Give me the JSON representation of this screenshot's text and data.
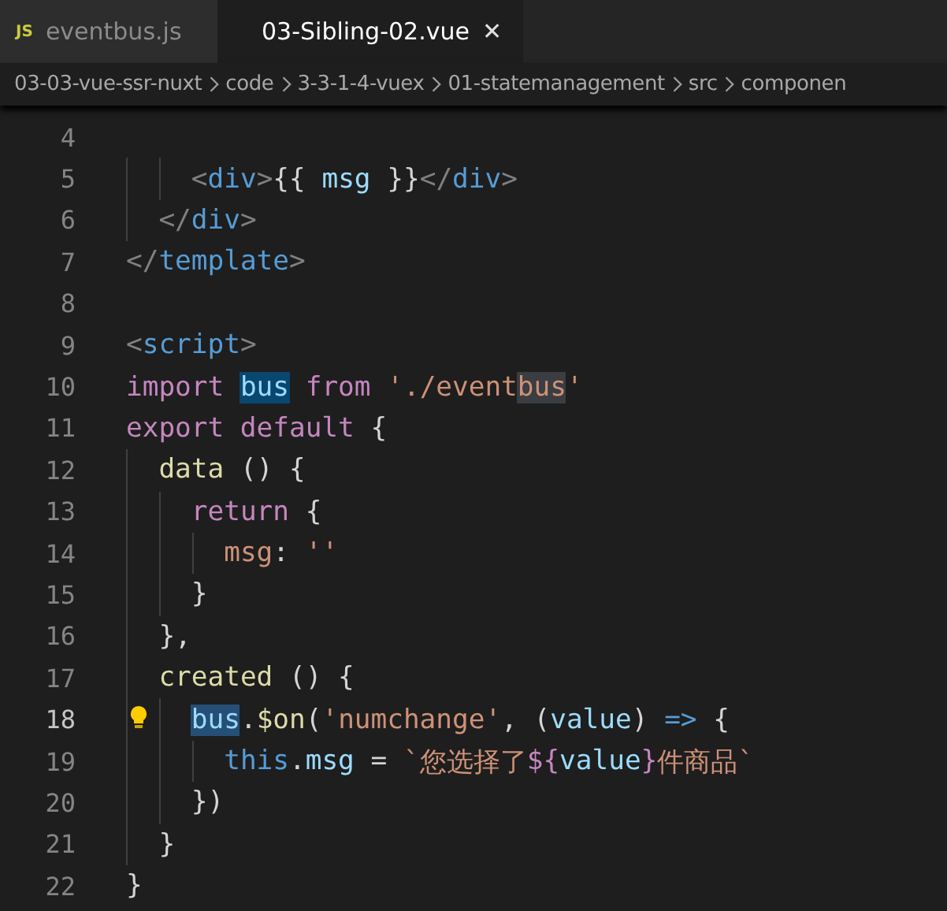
{
  "tabs": [
    {
      "label": "eventbus.js",
      "icon": "JS",
      "kind": "js",
      "selected": false
    },
    {
      "label": "03-Sibling-02.vue",
      "kind": "vue",
      "selected": true,
      "close": "✕"
    }
  ],
  "breadcrumbs": [
    "03-03-vue-ssr-nuxt",
    "code",
    "3-3-1-4-vuex",
    "01-statemanagement",
    "src",
    "componen"
  ],
  "lines": [
    {
      "number": "4",
      "current": false
    },
    {
      "number": "5",
      "current": false,
      "tokens": [
        {
          "text": "    <",
          "kind": "bracket"
        },
        {
          "text": "div",
          "kind": "tag"
        },
        {
          "text": ">",
          "kind": "bracket"
        },
        {
          "text": "{{ ",
          "kind": "text"
        },
        {
          "text": "msg",
          "kind": "variable"
        },
        {
          "text": " }}",
          "kind": "text"
        },
        {
          "text": "</",
          "kind": "bracket"
        },
        {
          "text": "div",
          "kind": "tag"
        },
        {
          "text": ">",
          "kind": "bracket"
        }
      ]
    },
    {
      "number": "6",
      "current": false,
      "tokens": [
        {
          "text": "  </",
          "kind": "bracket"
        },
        {
          "text": "div",
          "kind": "tag"
        },
        {
          "text": ">",
          "kind": "bracket"
        }
      ]
    },
    {
      "number": "7",
      "current": false,
      "tokens": [
        {
          "text": "</",
          "kind": "bracket"
        },
        {
          "text": "template",
          "kind": "tag"
        },
        {
          "text": ">",
          "kind": "bracket"
        }
      ]
    },
    {
      "number": "8",
      "current": false
    },
    {
      "number": "9",
      "current": false,
      "tokens": [
        {
          "text": "<",
          "kind": "bracket"
        },
        {
          "text": "script",
          "kind": "tag"
        },
        {
          "text": ">",
          "kind": "bracket"
        }
      ]
    },
    {
      "number": "10",
      "current": false,
      "tokens": [
        {
          "text": "import ",
          "kind": "keyword"
        },
        {
          "text": "bus",
          "kind": "highlight"
        },
        {
          "text": " from",
          "kind": "keyword"
        },
        {
          "text": " './event",
          "kind": "string"
        },
        {
          "text": "bus",
          "kind": "match"
        },
        {
          "text": "'",
          "kind": "string"
        }
      ]
    },
    {
      "number": "11",
      "current": false,
      "tokens": [
        {
          "text": "export default",
          "kind": "keyword"
        },
        {
          "text": " {",
          "kind": "text"
        }
      ]
    },
    {
      "number": "12",
      "current": false,
      "tokens": [
        {
          "text": "  data",
          "kind": "function"
        },
        {
          "text": " () {",
          "kind": "text"
        }
      ]
    },
    {
      "number": "13",
      "current": false,
      "tokens": [
        {
          "text": "    return",
          "kind": "keyword"
        },
        {
          "text": " {",
          "kind": "text"
        }
      ]
    },
    {
      "number": "14",
      "current": false,
      "tokens": [
        {
          "text": "      msg",
          "kind": "string"
        },
        {
          "text": ": ",
          "kind": "text"
        },
        {
          "text": "''",
          "kind": "string"
        }
      ]
    },
    {
      "number": "15",
      "current": false,
      "tokens": [
        {
          "text": "    }",
          "kind": "text"
        }
      ]
    },
    {
      "number": "16",
      "current": false,
      "tokens": [
        {
          "text": "  },",
          "kind": "text"
        }
      ]
    },
    {
      "number": "17",
      "current": false,
      "tokens": [
        {
          "text": "  created",
          "kind": "function"
        },
        {
          "text": " () {",
          "kind": "text"
        }
      ]
    },
    {
      "number": "18",
      "current": true,
      "tokens": [
        {
          "text": "    bus",
          "kind": "selection"
        },
        {
          "text": ".",
          "kind": "text"
        },
        {
          "text": "$on",
          "kind": "function"
        },
        {
          "text": "(",
          "kind": "text"
        },
        {
          "text": "'numchange'",
          "kind": "string"
        },
        {
          "text": ", (",
          "kind": "text"
        },
        {
          "text": "value",
          "kind": "variable"
        },
        {
          "text": ") ",
          "kind": "text"
        },
        {
          "text": "=>",
          "kind": "tag"
        },
        {
          "text": " {",
          "kind": "text"
        }
      ]
    },
    {
      "number": "19",
      "current": false,
      "tokens": [
        {
          "text": "      this",
          "kind": "tag"
        },
        {
          "text": ".",
          "kind": "text"
        },
        {
          "text": "msg",
          "kind": "variable"
        },
        {
          "text": " = ",
          "kind": "text"
        },
        {
          "text": "`您选择了",
          "kind": "string"
        },
        {
          "text": "${",
          "kind": "keyword"
        },
        {
          "text": "value",
          "kind": "variable"
        },
        {
          "text": "}",
          "kind": "keyword"
        },
        {
          "text": "件商品`",
          "kind": "string"
        }
      ]
    },
    {
      "number": "20",
      "current": false,
      "tokens": [
        {
          "text": "    })",
          "kind": "text"
        }
      ]
    },
    {
      "number": "21",
      "current": false,
      "tokens": [
        {
          "text": "  }",
          "kind": "text"
        }
      ]
    },
    {
      "number": "22",
      "current": false,
      "tokens": [
        {
          "text": "}",
          "kind": "text"
        }
      ]
    }
  ]
}
